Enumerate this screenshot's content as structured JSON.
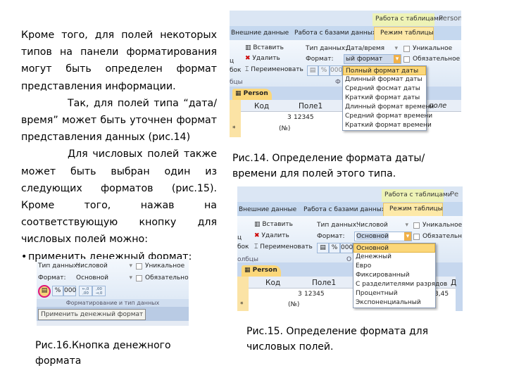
{
  "text": {
    "p1": "Кроме того, для полей некоторых типов на панели форматирования могут быть определен формат представления информации.",
    "p2": "Так, для полей типа “дата/время” может быть уточнен формат представления данных (рис.14)",
    "p3": "Для числовых полей также может быть выбран один из следующих форматов (рис.15). Кроме того, нажав на соответствующую кнопку для числовых полей можно:",
    "bullet": "•",
    "b1": "применить денежный формат:"
  },
  "captions": {
    "fig14": "Рис.14. Определение формата даты/времени для полей этого типа.",
    "fig15": "Рис.15. Определение формата для числовых полей.",
    "fig16": "Рис.16.Кнопка денежного формата"
  },
  "fig14": {
    "ctx_tab": "Работа с таблицами",
    "right_tab": "Person",
    "tabs": [
      "Внешние данные",
      "Работа с базами данных",
      "Режим таблицы"
    ],
    "insert": "Вставить",
    "delete": "Удалить",
    "rename": "Переименовать",
    "cut1": "ц",
    "cut2": "бок",
    "group": "бцы",
    "group2": "Ф",
    "type_label": "Тип данных:",
    "type_value": "Дата/время",
    "format_label": "Формат:",
    "format_value": "ый формат даты",
    "unique": "Уникальное",
    "required": "Обязательное",
    "pct": "%",
    "thousands": "000",
    "options": [
      "Полный формат даты",
      "Длинный формат даты",
      "Средний фосмат даты",
      "Краткий формат даты",
      "Длинный формат времени",
      "Средний формат времени",
      "Краткий формат времени"
    ],
    "table_tab": "Person",
    "cols": [
      "Код",
      "Поле1",
      "ь поле"
    ],
    "row1": [
      "3",
      "12345"
    ],
    "new_row": [
      "*",
      "(№)"
    ]
  },
  "fig15": {
    "ctx_tab": "Работа с таблицами",
    "right_tab": "Ре",
    "tabs": [
      "Внешние данные",
      "Работа с базами данных",
      "Режим таблицы"
    ],
    "insert": "Вставить",
    "delete": "Удалить",
    "rename": "Переименовать",
    "cut1": "ц",
    "cut2": "бок",
    "group": "олбцы",
    "group2": "О",
    "type_label": "Тип данных:",
    "type_value": "Числовой",
    "format_label": "Формат:",
    "format_value": "Основной",
    "unique": "Уникальное",
    "required": "Обязательн",
    "pct": "%",
    "thousands": "000",
    "options": [
      "Основной",
      "Денежный",
      "Евро",
      "Фиксированный",
      "С разделителями разрядов",
      "Процентный",
      "Экспоненциальный"
    ],
    "table_tab": "Person",
    "cols": [
      "Код",
      "Поле1",
      "Д"
    ],
    "row1": [
      "3",
      "12345",
      "3,45"
    ],
    "new_row": [
      "*",
      "(№)"
    ]
  },
  "fig16": {
    "type_label": "Тип данных:",
    "type_value": "Числовой",
    "format_label": "Формат:",
    "format_value": "Основной",
    "unique": "Уникальное",
    "required": "Обязательное",
    "pct": "%",
    "thousands": "000",
    "inc": "←,0 ,00",
    "dec": ",00 →,0",
    "group": "Форматирование и тип данных",
    "tooltip": "Применить денежный формат",
    "highlight_color": "#e0157a"
  }
}
